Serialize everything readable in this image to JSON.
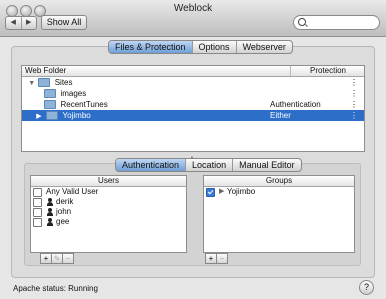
{
  "window": {
    "title": "Weblock"
  },
  "toolbar": {
    "back_label": "◀",
    "forward_label": "▶",
    "show_all_label": "Show All",
    "search_placeholder": ""
  },
  "top_tabs": [
    {
      "label": "Files & Protection",
      "selected": true
    },
    {
      "label": "Options",
      "selected": false
    },
    {
      "label": "Webserver",
      "selected": false
    }
  ],
  "folder_table": {
    "col_folder": "Web Folder",
    "col_protection": "Protection",
    "rows": [
      {
        "name": "Sites",
        "protection": "",
        "indent": 0,
        "disclosure": "▼",
        "selected": false
      },
      {
        "name": "images",
        "protection": "",
        "indent": 1,
        "disclosure": "",
        "selected": false
      },
      {
        "name": "RecentTunes",
        "protection": "Authentication",
        "indent": 1,
        "disclosure": "",
        "selected": false
      },
      {
        "name": "Yojimbo",
        "protection": "Either",
        "indent": 1,
        "disclosure": "▶",
        "selected": true
      }
    ],
    "stepper_glyph": "⋮"
  },
  "sub_tabs": [
    {
      "label": "Authentication",
      "selected": true
    },
    {
      "label": "Location",
      "selected": false
    },
    {
      "label": "Manual Editor",
      "selected": false
    }
  ],
  "users": {
    "header": "Users",
    "items": [
      {
        "label": "Any Valid User",
        "checked": false,
        "icon": "none"
      },
      {
        "label": "derik",
        "checked": false,
        "icon": "person-icon"
      },
      {
        "label": "john",
        "checked": false,
        "icon": "person-icon"
      },
      {
        "label": "gee",
        "checked": false,
        "icon": "person-icon"
      }
    ]
  },
  "groups": {
    "header": "Groups",
    "items": [
      {
        "label": "Yojimbo",
        "checked": true,
        "disclosure": "▶"
      }
    ]
  },
  "buttons": {
    "add": "+",
    "edit": "✎",
    "remove": "−"
  },
  "status": {
    "text": "Apache status: Running"
  },
  "help": {
    "label": "?"
  },
  "colors": {
    "selection": "#2d6fc8",
    "tab_selected": "#6f9fd6"
  }
}
